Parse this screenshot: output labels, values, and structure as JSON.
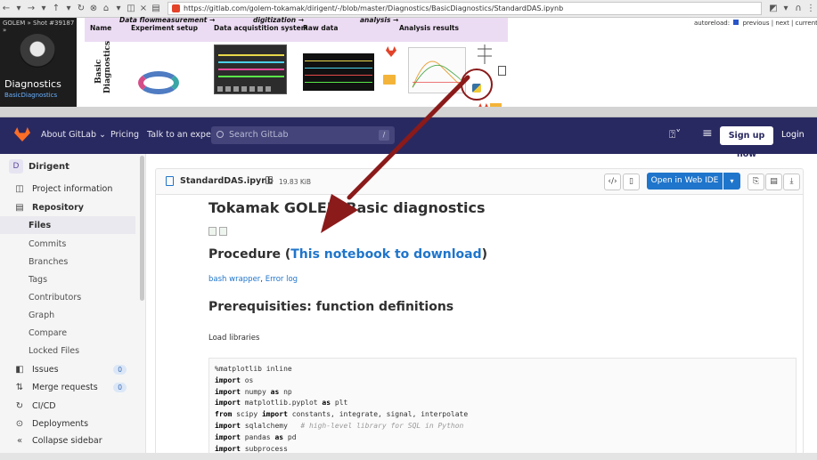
{
  "browser": {
    "url": "https://gitlab.com/golem-tokamak/dirigent/-/blob/master/Diagnostics/BasicDiagnostics/StandardDAS.ipynb"
  },
  "golem": {
    "shot_label": "GOLEM » Shot #39187 »",
    "title": "Diagnostics",
    "subtitle": "BasicDiagnostics",
    "autoreload": "autoreload:",
    "nav": "previous | next | current",
    "headers_top": [
      "Data flow",
      "measurement →",
      "digitization →",
      "analysis →"
    ],
    "headers": [
      "Name",
      "Experiment setup",
      "Data acquistition system",
      "Raw data",
      "Analysis results"
    ],
    "basic_label": "Basic Diagnostics"
  },
  "navbar": {
    "about": "About GitLab ⌄",
    "pricing": "Pricing",
    "talk": "Talk to an expert",
    "search_placeholder": "Search GitLab",
    "slash": "/",
    "signup": "Sign up now",
    "login": "Login"
  },
  "sidebar": {
    "project_initial": "D",
    "project_name": "Dirigent",
    "items": [
      {
        "icon": "◫",
        "label": "Project information"
      },
      {
        "icon": "▤",
        "label": "Repository"
      },
      {
        "label": "Files"
      },
      {
        "label": "Commits"
      },
      {
        "label": "Branches"
      },
      {
        "label": "Tags"
      },
      {
        "label": "Contributors"
      },
      {
        "label": "Graph"
      },
      {
        "label": "Compare"
      },
      {
        "label": "Locked Files"
      },
      {
        "icon": "◧",
        "label": "Issues",
        "badge": "0"
      },
      {
        "icon": "⇅",
        "label": "Merge requests",
        "badge": "0"
      },
      {
        "icon": "↻",
        "label": "CI/CD"
      },
      {
        "icon": "⊙",
        "label": "Deployments"
      },
      {
        "icon": "«",
        "label": "Collapse sidebar"
      }
    ]
  },
  "file": {
    "name": "StandardDAS.ipynb",
    "size": "19.83 KiB",
    "open_ide": "Open in Web IDE"
  },
  "notebook": {
    "title": "Tokamak GOLEM Basic diagnostics",
    "procedure_prefix": "Procedure (",
    "procedure_link": "This notebook to download",
    "procedure_suffix": ")",
    "link_bash": "bash wrapper",
    "link_sep": ", ",
    "link_error": "Error log",
    "prereq": "Prerequisities: function definitions",
    "load_libraries": "Load libraries",
    "code_lines": [
      [
        {
          "t": "%matplotlib inline"
        }
      ],
      [
        {
          "t": "import",
          "k": 1
        },
        {
          "t": " os"
        }
      ],
      [
        {
          "t": "import",
          "k": 1
        },
        {
          "t": " numpy "
        },
        {
          "t": "as",
          "k": 1
        },
        {
          "t": " np"
        }
      ],
      [
        {
          "t": "import",
          "k": 1
        },
        {
          "t": " matplotlib.pyplot "
        },
        {
          "t": "as",
          "k": 1
        },
        {
          "t": " plt"
        }
      ],
      [
        {
          "t": "from",
          "k": 1
        },
        {
          "t": " scipy "
        },
        {
          "t": "import",
          "k": 1
        },
        {
          "t": " constants, integrate, signal, interpolate"
        }
      ],
      [
        {
          "t": "import",
          "k": 1
        },
        {
          "t": " sqlalchemy   "
        },
        {
          "t": "# high-level library for SQL in Python",
          "c": 1
        }
      ],
      [
        {
          "t": "import",
          "k": 1
        },
        {
          "t": " pandas "
        },
        {
          "t": "as",
          "k": 1
        },
        {
          "t": " pd"
        }
      ],
      [
        {
          "t": "import",
          "k": 1
        },
        {
          "t": " subprocess"
        }
      ]
    ]
  },
  "colors": {
    "navbar": "#292961",
    "link": "#1f75cb",
    "arrow": "#8b1a1a",
    "gitlab_orange": "#fc6d26"
  }
}
